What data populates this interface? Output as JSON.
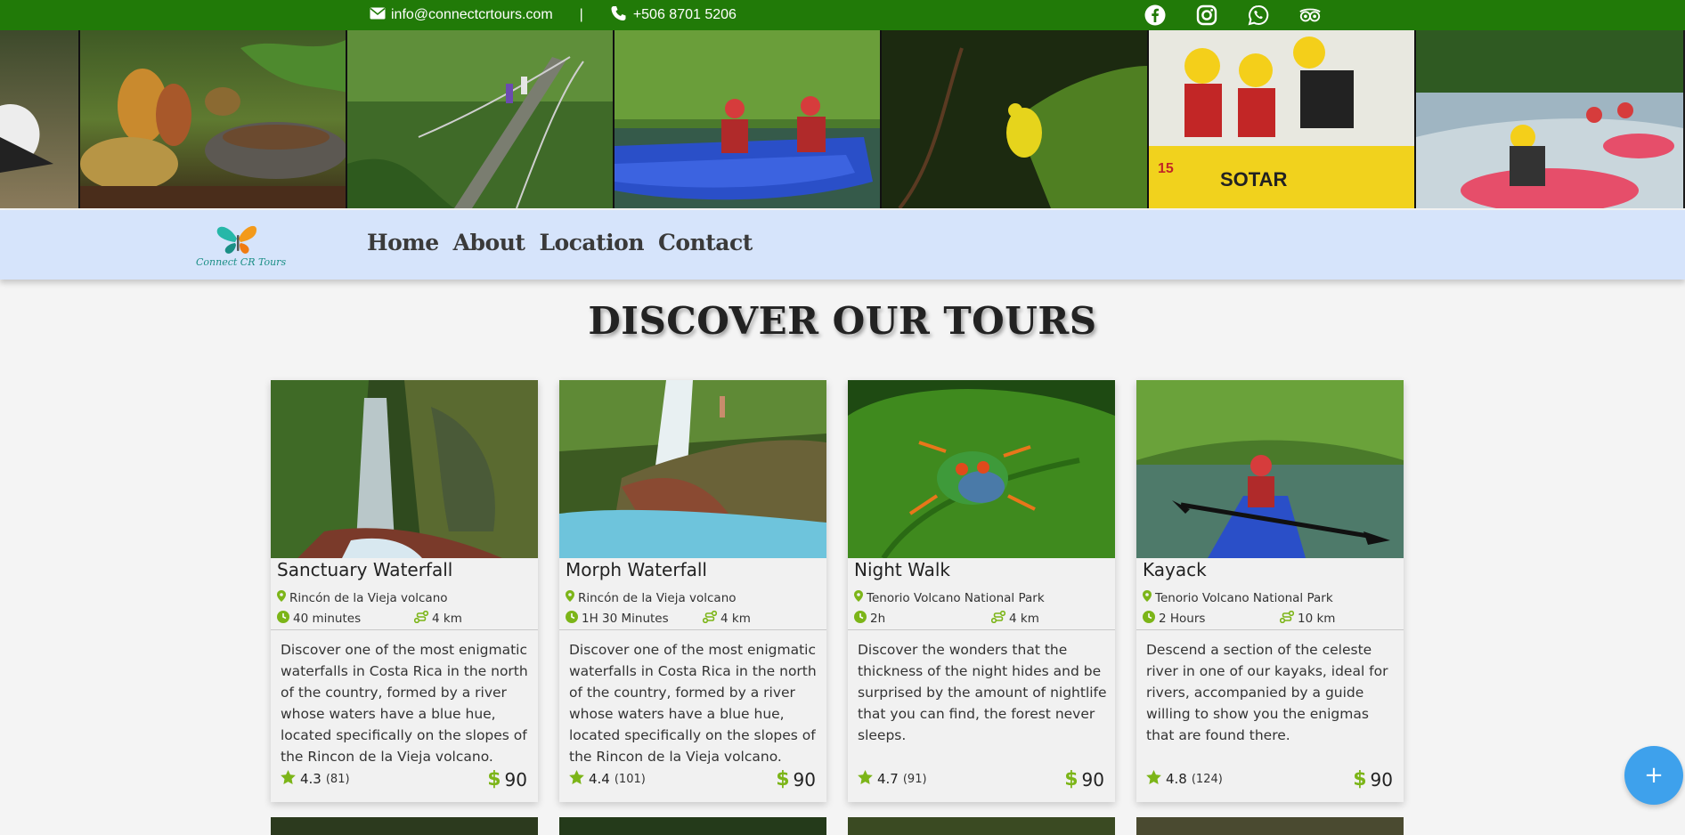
{
  "topbar": {
    "email": "info@connectcrtours.com",
    "separator": "|",
    "phone": "+506 8701 5206",
    "social": [
      "facebook-icon",
      "instagram-icon",
      "whatsapp-icon",
      "tripadvisor-icon"
    ]
  },
  "nav": {
    "brand": "Connect CR Tours",
    "items": [
      "Home",
      "About",
      "Location",
      "Contact"
    ]
  },
  "heading": "DISCOVER OUR TOURS",
  "colors": {
    "topbar": "#217a08",
    "navbar": "#d6e4fb",
    "accent_green": "#7cb518",
    "fab": "#3ea1ec"
  },
  "tours": [
    {
      "title": "Sanctuary Waterfall",
      "location": "Rincón de la Vieja volcano",
      "duration": "40 minutes",
      "distance": "4 km",
      "description": "Discover one of the most enigmatic waterfalls in Costa Rica in the north of the country, formed by a river whose waters have a blue hue, located specifically on the slopes of the Rincon de la Vieja volcano.",
      "rating": "4.3",
      "reviews": "(81)",
      "currency": "$",
      "price": "90"
    },
    {
      "title": "Morph Waterfall",
      "location": "Rincón de la Vieja volcano",
      "duration": "1H 30 Minutes",
      "distance": "4 km",
      "description": "Discover one of the most enigmatic waterfalls in Costa Rica in the north of the country, formed by a river whose waters have a blue hue, located specifically on the slopes of the Rincon de la Vieja volcano.",
      "rating": "4.4",
      "reviews": "(101)",
      "currency": "$",
      "price": "90"
    },
    {
      "title": "Night Walk",
      "location": "Tenorio Volcano National Park",
      "duration": "2h",
      "distance": "4 km",
      "description": "Discover the wonders that the thickness of the night hides and be surprised by the amount of nightlife that you can find, the forest never sleeps.",
      "rating": "4.7",
      "reviews": "(91)",
      "currency": "$",
      "price": "90"
    },
    {
      "title": "Kayack",
      "location": "Tenorio Volcano National Park",
      "duration": "2 Hours",
      "distance": "10 km",
      "description": "Descend a section of the celeste river in one of our kayaks, ideal for rivers, accompanied by a guide willing to show you the enigmas that are found there.",
      "rating": "4.8",
      "reviews": "(124)",
      "currency": "$",
      "price": "90"
    }
  ],
  "fab_label": "+"
}
